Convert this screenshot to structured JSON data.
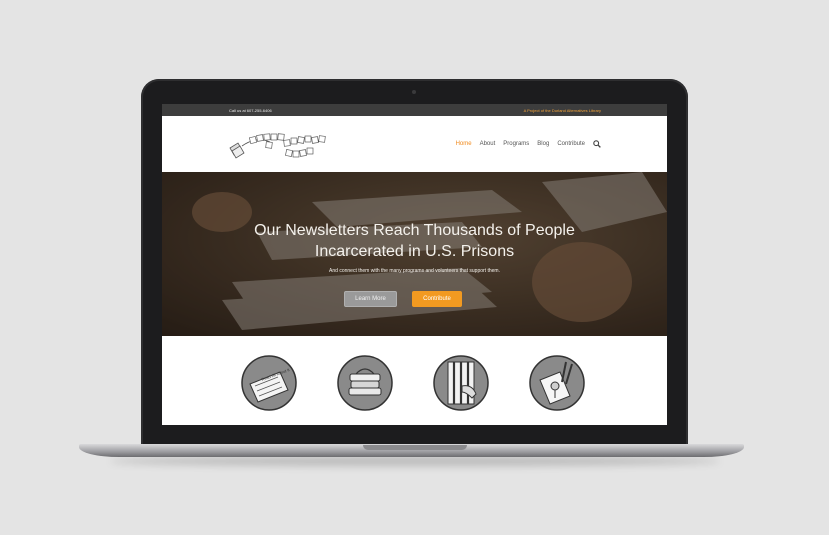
{
  "topbar": {
    "call": "Call us at 607-255-6406",
    "project": "A Project of the Durland Alternatives Library"
  },
  "nav": {
    "items": [
      "Home",
      "About",
      "Programs",
      "Blog",
      "Contribute"
    ],
    "active": "Home",
    "search_icon": "search-icon"
  },
  "hero": {
    "title_line1": "Our Newsletters Reach Thousands of People",
    "title_line2": "Incarcerated in U.S. Prisons",
    "subtitle": "And connect them with the many programs and volunteers that support them.",
    "learn_more": "Learn More",
    "contribute": "Contribute"
  },
  "features": {
    "icons": [
      "newspaper-icon",
      "books-icon",
      "prison-bars-icon",
      "art-supplies-icon"
    ]
  },
  "colors": {
    "accent": "#f29a21",
    "topbar": "#3d3d3d",
    "laptop": "#1c1c1e"
  }
}
